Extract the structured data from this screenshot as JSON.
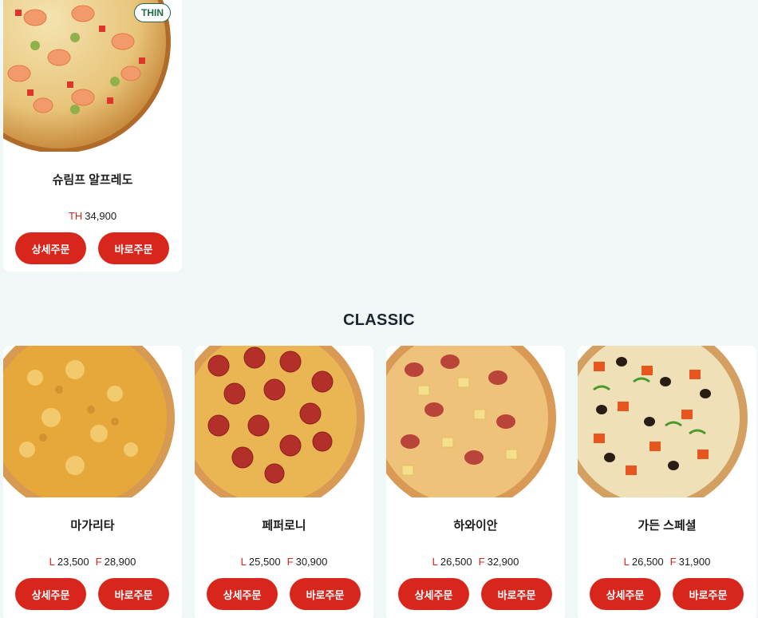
{
  "top_card": {
    "name": "슈림프 알프레도",
    "badge": "THIN",
    "price_label": "TH",
    "price": "34,900",
    "detail_button": "상세주문",
    "order_button": "바로주문"
  },
  "section": {
    "title": "CLASSIC"
  },
  "classic_items": [
    {
      "name": "마가리타",
      "l_label": "L",
      "l_price": "23,500",
      "f_label": "F",
      "f_price": "28,900",
      "detail_button": "상세주문",
      "order_button": "바로주문"
    },
    {
      "name": "페퍼로니",
      "l_label": "L",
      "l_price": "25,500",
      "f_label": "F",
      "f_price": "30,900",
      "detail_button": "상세주문",
      "order_button": "바로주문"
    },
    {
      "name": "하와이안",
      "l_label": "L",
      "l_price": "26,500",
      "f_label": "F",
      "f_price": "32,900",
      "detail_button": "상세주문",
      "order_button": "바로주문"
    },
    {
      "name": "가든 스페셜",
      "l_label": "L",
      "l_price": "26,500",
      "f_label": "F",
      "f_price": "31,900",
      "detail_button": "상세주문",
      "order_button": "바로주문"
    }
  ],
  "colors": {
    "background": "#f0f7f6",
    "accent": "#d8261c",
    "badge": "#1e6b44"
  }
}
